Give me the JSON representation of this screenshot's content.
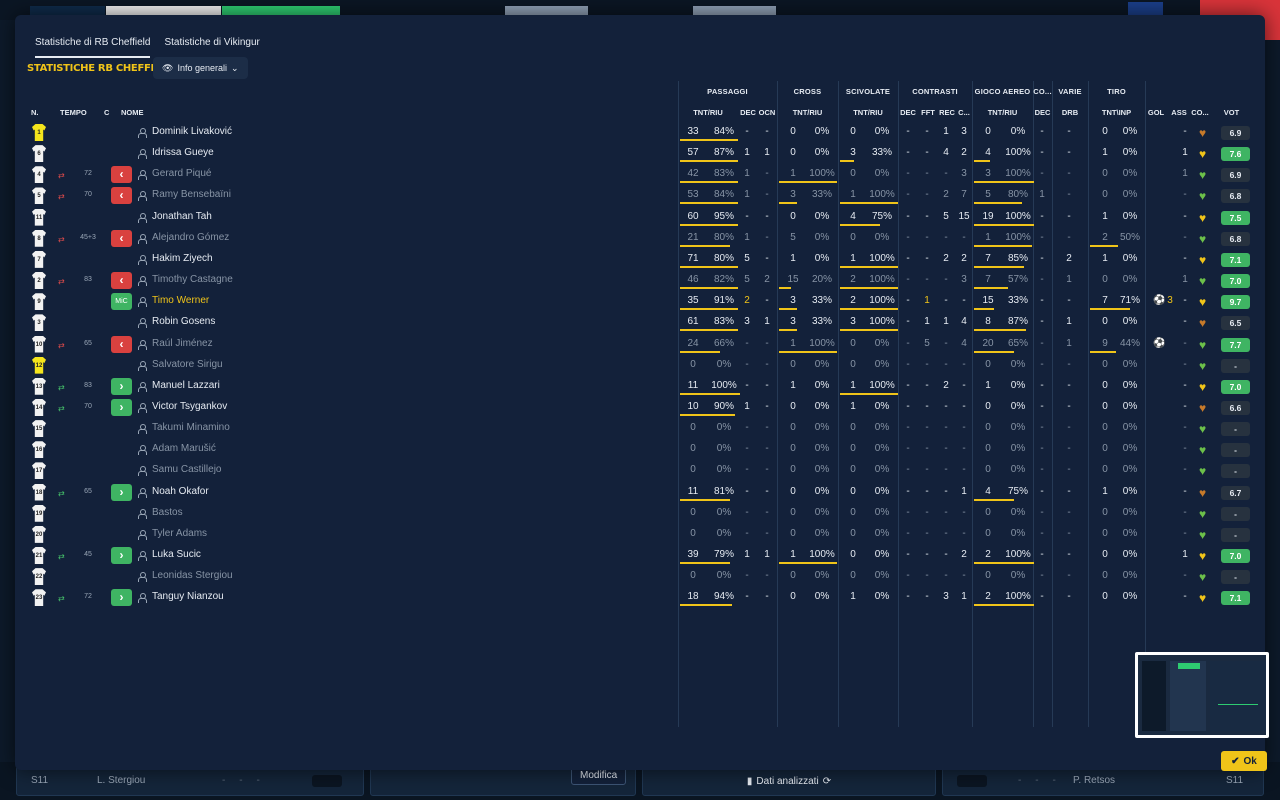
{
  "tabs": [
    "Statistiche di RB Cheffield",
    "Statistiche di Vikingur"
  ],
  "section_title": "STATISTICHE RB CHEFFIELD",
  "view_dropdown": "Info generali",
  "left_headers": {
    "num": "N.",
    "time": "TEMPO",
    "c": "C",
    "name": "NOME"
  },
  "group_headers": [
    {
      "label": "PASSAGGI"
    },
    {
      "label": "CROSS"
    },
    {
      "label": "SCIVOLATE"
    },
    {
      "label": "CONTRASTI"
    },
    {
      "label": "GIOCO AEREO"
    },
    {
      "label": "CO..."
    },
    {
      "label": "VARIE"
    },
    {
      "label": "TIRO"
    }
  ],
  "col_headers": {
    "pass": "TNT/RIU",
    "pass_dec": "DEC",
    "pass_ocn": "OCN",
    "cross": "TNT/RIU",
    "slide": "TNT/RIU",
    "ct_dec": "DEC",
    "ct_fft": "FFT",
    "ct_rec": "REC",
    "ct_c": "C...",
    "air": "TNT/RIU",
    "co_dec": "DEC",
    "drb": "DRB",
    "shot": "TNT\\INP",
    "gol": "GOL",
    "ass": "ASS",
    "co": "CO...",
    "vot": "VOT"
  },
  "players": [
    {
      "num": "1",
      "gk": true,
      "status": "played",
      "name": "Dominik Livaković",
      "p": [
        "33",
        "84%"
      ],
      "pd": "-",
      "po": "-",
      "c": [
        "0",
        "0%"
      ],
      "s": [
        "0",
        "0%"
      ],
      "cd": "-",
      "cf": "-",
      "cr": "1",
      "cc": "3",
      "a": [
        "0",
        "0%"
      ],
      "co": "-",
      "dr": "-",
      "t": [
        "0",
        "0%"
      ],
      "gol": "",
      "ass": "-",
      "vote": "6.9",
      "vg": false,
      "bars": {
        "p": 58,
        "s": 0,
        "c": 0,
        "a": 0,
        "t": 0
      }
    },
    {
      "num": "6",
      "status": "played",
      "name": "Idrissa Gueye",
      "p": [
        "57",
        "87%"
      ],
      "pd": "1",
      "po": "1",
      "c": [
        "0",
        "0%"
      ],
      "s": [
        "3",
        "33%"
      ],
      "cd": "-",
      "cf": "-",
      "cr": "4",
      "cc": "2",
      "a": [
        "4",
        "100%"
      ],
      "co": "-",
      "dr": "-",
      "t": [
        "1",
        "0%"
      ],
      "gol": "",
      "ass": "1",
      "vote": "7.6",
      "vg": true,
      "bars": {
        "p": 58,
        "s": 14,
        "c": 0,
        "a": 16,
        "t": 0
      }
    },
    {
      "num": "4",
      "status": "unused",
      "sub": "out",
      "min": "72",
      "name": "Gerard Piqué",
      "p": [
        "42",
        "83%"
      ],
      "pd": "1",
      "po": "-",
      "c": [
        "1",
        "100%"
      ],
      "s": [
        "0",
        "0%"
      ],
      "cd": "-",
      "cf": "-",
      "cr": "-",
      "cc": "3",
      "a": [
        "3",
        "100%"
      ],
      "co": "-",
      "dr": "-",
      "t": [
        "0",
        "0%"
      ],
      "gol": "",
      "ass": "1",
      "vote": "6.9",
      "vg": false,
      "bars": {
        "p": 58,
        "s": 0,
        "c": 58,
        "a": 60,
        "t": 0
      }
    },
    {
      "num": "5",
      "status": "unused",
      "sub": "out",
      "min": "70",
      "name": "Ramy Bensebaïni",
      "p": [
        "53",
        "84%"
      ],
      "pd": "1",
      "po": "-",
      "c": [
        "3",
        "33%"
      ],
      "s": [
        "1",
        "100%"
      ],
      "cd": "-",
      "cf": "-",
      "cr": "2",
      "cc": "7",
      "a": [
        "5",
        "80%"
      ],
      "co": "1",
      "dr": "-",
      "t": [
        "0",
        "0%"
      ],
      "gol": "",
      "ass": "-",
      "vote": "6.8",
      "vg": false,
      "bars": {
        "p": 58,
        "s": 58,
        "c": 18,
        "a": 48,
        "t": 0
      }
    },
    {
      "num": "11",
      "status": "played",
      "name": "Jonathan Tah",
      "p": [
        "60",
        "95%"
      ],
      "pd": "-",
      "po": "-",
      "c": [
        "0",
        "0%"
      ],
      "s": [
        "4",
        "75%"
      ],
      "cd": "-",
      "cf": "-",
      "cr": "5",
      "cc": "15",
      "a": [
        "19",
        "100%"
      ],
      "co": "-",
      "dr": "-",
      "t": [
        "1",
        "0%"
      ],
      "gol": "",
      "ass": "-",
      "vote": "7.5",
      "vg": true,
      "bars": {
        "p": 58,
        "s": 40,
        "c": 0,
        "a": 60,
        "t": 0
      }
    },
    {
      "num": "8",
      "status": "unused",
      "sub": "out",
      "min": "45+3",
      "name": "Alejandro Gómez",
      "p": [
        "21",
        "80%"
      ],
      "pd": "1",
      "po": "-",
      "c": [
        "5",
        "0%"
      ],
      "s": [
        "0",
        "0%"
      ],
      "cd": "-",
      "cf": "-",
      "cr": "-",
      "cc": "-",
      "a": [
        "1",
        "100%"
      ],
      "co": "-",
      "dr": "-",
      "t": [
        "2",
        "50%"
      ],
      "gol": "",
      "ass": "-",
      "vote": "6.8",
      "vg": false,
      "bars": {
        "p": 50,
        "s": 0,
        "c": 0,
        "a": 58,
        "t": 28
      }
    },
    {
      "num": "7",
      "status": "played",
      "name": "Hakim Ziyech",
      "p": [
        "71",
        "80%"
      ],
      "pd": "5",
      "po": "-",
      "c": [
        "1",
        "0%"
      ],
      "s": [
        "1",
        "100%"
      ],
      "cd": "-",
      "cf": "-",
      "cr": "2",
      "cc": "2",
      "a": [
        "7",
        "85%"
      ],
      "co": "-",
      "dr": "2",
      "t": [
        "1",
        "0%"
      ],
      "gol": "",
      "ass": "-",
      "vote": "7.1",
      "vg": true,
      "bars": {
        "p": 58,
        "s": 58,
        "c": 0,
        "a": 50,
        "t": 0
      }
    },
    {
      "num": "2",
      "status": "unused",
      "sub": "out",
      "min": "83",
      "name": "Timothy Castagne",
      "p": [
        "46",
        "82%"
      ],
      "pd": "5",
      "po": "2",
      "c": [
        "15",
        "20%"
      ],
      "s": [
        "2",
        "100%"
      ],
      "cd": "-",
      "cf": "-",
      "cr": "-",
      "cc": "3",
      "a": [
        "7",
        "57%"
      ],
      "co": "-",
      "dr": "1",
      "t": [
        "0",
        "0%"
      ],
      "gol": "",
      "ass": "1",
      "vote": "7.0",
      "vg": true,
      "bars": {
        "p": 58,
        "s": 58,
        "c": 12,
        "a": 34,
        "t": 0
      }
    },
    {
      "num": "9",
      "status": "hl",
      "cbadge": "mic",
      "name": "Timo Werner",
      "p": [
        "35",
        "91%"
      ],
      "pd": "2",
      "po": "-",
      "c": [
        "3",
        "33%"
      ],
      "s": [
        "2",
        "100%"
      ],
      "cd": "-",
      "cf": "1",
      "cr": "-",
      "cc": "-",
      "a": [
        "15",
        "33%"
      ],
      "co": "-",
      "dr": "-",
      "t": [
        "7",
        "71%"
      ],
      "gol": "3",
      "ass": "-",
      "vote": "9.7",
      "vg": true,
      "bars": {
        "p": 58,
        "s": 58,
        "c": 18,
        "a": 20,
        "t": 40
      }
    },
    {
      "num": "3",
      "status": "played",
      "name": "Robin Gosens",
      "p": [
        "61",
        "83%"
      ],
      "pd": "3",
      "po": "1",
      "c": [
        "3",
        "33%"
      ],
      "s": [
        "3",
        "100%"
      ],
      "cd": "-",
      "cf": "1",
      "cr": "1",
      "cc": "4",
      "a": [
        "8",
        "87%"
      ],
      "co": "-",
      "dr": "1",
      "t": [
        "0",
        "0%"
      ],
      "gol": "",
      "ass": "-",
      "vote": "6.5",
      "vg": false,
      "bars": {
        "p": 58,
        "s": 58,
        "c": 18,
        "a": 52,
        "t": 0
      }
    },
    {
      "num": "10",
      "status": "unused",
      "sub": "out",
      "min": "65",
      "name": "Raúl Jiménez",
      "p": [
        "24",
        "66%"
      ],
      "pd": "-",
      "po": "-",
      "c": [
        "1",
        "100%"
      ],
      "s": [
        "0",
        "0%"
      ],
      "cd": "-",
      "cf": "5",
      "cr": "-",
      "cc": "4",
      "a": [
        "20",
        "65%"
      ],
      "co": "-",
      "dr": "1",
      "t": [
        "9",
        "44%"
      ],
      "gol": "1",
      "ass": "-",
      "vote": "7.7",
      "vg": true,
      "bars": {
        "p": 40,
        "s": 0,
        "c": 58,
        "a": 40,
        "t": 26
      }
    },
    {
      "num": "12",
      "gk": true,
      "status": "unused",
      "name": "Salvatore Sirigu",
      "p": [
        "0",
        "0%"
      ],
      "pd": "-",
      "po": "-",
      "c": [
        "0",
        "0%"
      ],
      "s": [
        "0",
        "0%"
      ],
      "cd": "-",
      "cf": "-",
      "cr": "-",
      "cc": "-",
      "a": [
        "0",
        "0%"
      ],
      "co": "-",
      "dr": "-",
      "t": [
        "0",
        "0%"
      ],
      "gol": "",
      "ass": "-",
      "vote": "-",
      "vg": false,
      "bars": {
        "p": 0,
        "s": 0,
        "c": 0,
        "a": 0,
        "t": 0
      }
    },
    {
      "num": "13",
      "status": "played",
      "sub": "in",
      "min": "83",
      "cbadge": "in",
      "name": "Manuel Lazzari",
      "p": [
        "11",
        "100%"
      ],
      "pd": "-",
      "po": "-",
      "c": [
        "1",
        "0%"
      ],
      "s": [
        "1",
        "100%"
      ],
      "cd": "-",
      "cf": "-",
      "cr": "2",
      "cc": "-",
      "a": [
        "1",
        "0%"
      ],
      "co": "-",
      "dr": "-",
      "t": [
        "0",
        "0%"
      ],
      "gol": "",
      "ass": "-",
      "vote": "7.0",
      "vg": true,
      "bars": {
        "p": 60,
        "s": 58,
        "c": 0,
        "a": 0,
        "t": 0
      }
    },
    {
      "num": "14",
      "status": "played",
      "sub": "in",
      "min": "70",
      "cbadge": "in",
      "name": "Victor Tsygankov",
      "p": [
        "10",
        "90%"
      ],
      "pd": "1",
      "po": "-",
      "c": [
        "0",
        "0%"
      ],
      "s": [
        "1",
        "0%"
      ],
      "cd": "-",
      "cf": "-",
      "cr": "-",
      "cc": "-",
      "a": [
        "0",
        "0%"
      ],
      "co": "-",
      "dr": "-",
      "t": [
        "0",
        "0%"
      ],
      "gol": "",
      "ass": "-",
      "vote": "6.6",
      "vg": false,
      "bars": {
        "p": 55,
        "s": 0,
        "c": 0,
        "a": 0,
        "t": 0
      }
    },
    {
      "num": "15",
      "status": "unused",
      "name": "Takumi Minamino",
      "p": [
        "0",
        "0%"
      ],
      "pd": "-",
      "po": "-",
      "c": [
        "0",
        "0%"
      ],
      "s": [
        "0",
        "0%"
      ],
      "cd": "-",
      "cf": "-",
      "cr": "-",
      "cc": "-",
      "a": [
        "0",
        "0%"
      ],
      "co": "-",
      "dr": "-",
      "t": [
        "0",
        "0%"
      ],
      "gol": "",
      "ass": "-",
      "vote": "-",
      "vg": false,
      "bars": {
        "p": 0,
        "s": 0,
        "c": 0,
        "a": 0,
        "t": 0
      }
    },
    {
      "num": "16",
      "status": "unused",
      "name": "Adam Marušić",
      "p": [
        "0",
        "0%"
      ],
      "pd": "-",
      "po": "-",
      "c": [
        "0",
        "0%"
      ],
      "s": [
        "0",
        "0%"
      ],
      "cd": "-",
      "cf": "-",
      "cr": "-",
      "cc": "-",
      "a": [
        "0",
        "0%"
      ],
      "co": "-",
      "dr": "-",
      "t": [
        "0",
        "0%"
      ],
      "gol": "",
      "ass": "-",
      "vote": "-",
      "vg": false,
      "bars": {
        "p": 0,
        "s": 0,
        "c": 0,
        "a": 0,
        "t": 0
      }
    },
    {
      "num": "17",
      "status": "unused",
      "name": "Samu Castillejo",
      "p": [
        "0",
        "0%"
      ],
      "pd": "-",
      "po": "-",
      "c": [
        "0",
        "0%"
      ],
      "s": [
        "0",
        "0%"
      ],
      "cd": "-",
      "cf": "-",
      "cr": "-",
      "cc": "-",
      "a": [
        "0",
        "0%"
      ],
      "co": "-",
      "dr": "-",
      "t": [
        "0",
        "0%"
      ],
      "gol": "",
      "ass": "-",
      "vote": "-",
      "vg": false,
      "bars": {
        "p": 0,
        "s": 0,
        "c": 0,
        "a": 0,
        "t": 0
      }
    },
    {
      "num": "18",
      "status": "played",
      "sub": "in",
      "min": "65",
      "cbadge": "in",
      "name": "Noah Okafor",
      "p": [
        "11",
        "81%"
      ],
      "pd": "-",
      "po": "-",
      "c": [
        "0",
        "0%"
      ],
      "s": [
        "0",
        "0%"
      ],
      "cd": "-",
      "cf": "-",
      "cr": "-",
      "cc": "1",
      "a": [
        "4",
        "75%"
      ],
      "co": "-",
      "dr": "-",
      "t": [
        "1",
        "0%"
      ],
      "gol": "",
      "ass": "-",
      "vote": "6.7",
      "vg": false,
      "bars": {
        "p": 50,
        "s": 0,
        "c": 0,
        "a": 40,
        "t": 0
      }
    },
    {
      "num": "19",
      "status": "unused",
      "name": "Bastos",
      "p": [
        "0",
        "0%"
      ],
      "pd": "-",
      "po": "-",
      "c": [
        "0",
        "0%"
      ],
      "s": [
        "0",
        "0%"
      ],
      "cd": "-",
      "cf": "-",
      "cr": "-",
      "cc": "-",
      "a": [
        "0",
        "0%"
      ],
      "co": "-",
      "dr": "-",
      "t": [
        "0",
        "0%"
      ],
      "gol": "",
      "ass": "-",
      "vote": "-",
      "vg": false,
      "bars": {
        "p": 0,
        "s": 0,
        "c": 0,
        "a": 0,
        "t": 0
      }
    },
    {
      "num": "20",
      "status": "unused",
      "name": "Tyler Adams",
      "p": [
        "0",
        "0%"
      ],
      "pd": "-",
      "po": "-",
      "c": [
        "0",
        "0%"
      ],
      "s": [
        "0",
        "0%"
      ],
      "cd": "-",
      "cf": "-",
      "cr": "-",
      "cc": "-",
      "a": [
        "0",
        "0%"
      ],
      "co": "-",
      "dr": "-",
      "t": [
        "0",
        "0%"
      ],
      "gol": "",
      "ass": "-",
      "vote": "-",
      "vg": false,
      "bars": {
        "p": 0,
        "s": 0,
        "c": 0,
        "a": 0,
        "t": 0
      }
    },
    {
      "num": "21",
      "status": "played",
      "sub": "in",
      "min": "45",
      "cbadge": "in",
      "name": "Luka Sucic",
      "p": [
        "39",
        "79%"
      ],
      "pd": "1",
      "po": "1",
      "c": [
        "1",
        "100%"
      ],
      "s": [
        "0",
        "0%"
      ],
      "cd": "-",
      "cf": "-",
      "cr": "-",
      "cc": "2",
      "a": [
        "2",
        "100%"
      ],
      "co": "-",
      "dr": "-",
      "t": [
        "0",
        "0%"
      ],
      "gol": "",
      "ass": "1",
      "vote": "7.0",
      "vg": true,
      "bars": {
        "p": 50,
        "s": 0,
        "c": 58,
        "a": 60,
        "t": 0
      }
    },
    {
      "num": "22",
      "status": "unused",
      "name": "Leonidas Stergiou",
      "p": [
        "0",
        "0%"
      ],
      "pd": "-",
      "po": "-",
      "c": [
        "0",
        "0%"
      ],
      "s": [
        "0",
        "0%"
      ],
      "cd": "-",
      "cf": "-",
      "cr": "-",
      "cc": "-",
      "a": [
        "0",
        "0%"
      ],
      "co": "-",
      "dr": "-",
      "t": [
        "0",
        "0%"
      ],
      "gol": "",
      "ass": "-",
      "vote": "-",
      "vg": false,
      "bars": {
        "p": 0,
        "s": 0,
        "c": 0,
        "a": 0,
        "t": 0
      }
    },
    {
      "num": "23",
      "status": "played",
      "sub": "in",
      "min": "72",
      "cbadge": "in",
      "name": "Tanguy Nianzou",
      "p": [
        "18",
        "94%"
      ],
      "pd": "-",
      "po": "-",
      "c": [
        "0",
        "0%"
      ],
      "s": [
        "1",
        "0%"
      ],
      "cd": "-",
      "cf": "-",
      "cr": "3",
      "cc": "1",
      "a": [
        "2",
        "100%"
      ],
      "co": "-",
      "dr": "-",
      "t": [
        "0",
        "0%"
      ],
      "gol": "",
      "ass": "-",
      "vote": "7.1",
      "vg": true,
      "bars": {
        "p": 52,
        "s": 0,
        "c": 0,
        "a": 60,
        "t": 0
      }
    }
  ],
  "ok_label": "Ok",
  "bottom_bar": {
    "left_label": "S11",
    "left_player": "L. Stergiou",
    "modifica": "Modifica",
    "dati": "Dati analizzati",
    "right_player": "P. Retsos",
    "right_label": "S11"
  },
  "colors": {
    "accent": "#f0c419",
    "sub_out": "#d9413f",
    "sub_in": "#3fb463",
    "modal_bg": "#13213a"
  }
}
